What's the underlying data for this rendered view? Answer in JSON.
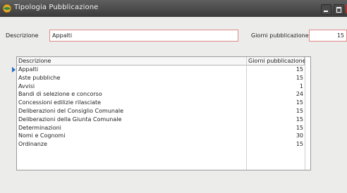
{
  "window": {
    "title": "Tipologia Pubblicazione"
  },
  "form": {
    "descrizione_label": "Descrizione",
    "descrizione_value": "Appalti",
    "giorni_label": "Giorni pubblicazione",
    "giorni_value": "15"
  },
  "grid": {
    "columns": [
      "Descrizione",
      "Giorni pubblicazione"
    ],
    "rows": [
      {
        "desc": "Appalti",
        "days": "15"
      },
      {
        "desc": "Aste pubbliche",
        "days": "15"
      },
      {
        "desc": "Avvisi",
        "days": "1"
      },
      {
        "desc": "Bandi di selezione e concorso",
        "days": "24"
      },
      {
        "desc": "Concessioni edilizie rilasciate",
        "days": "15"
      },
      {
        "desc": "Deliberazioni del Consiglio Comunale",
        "days": "15"
      },
      {
        "desc": "Deliberazioni della Giunta Comunale",
        "days": "15"
      },
      {
        "desc": "Determinazioni",
        "days": "15"
      },
      {
        "desc": "Nomi e Cognomi",
        "days": "30"
      },
      {
        "desc": "Ordinanze",
        "days": "15"
      }
    ],
    "selected_index": 0
  },
  "icons": {
    "app": "app-globe-icon",
    "minimize": "minimize-icon",
    "maximize": "maximize-icon",
    "close": "close-icon",
    "row_pointer": "row-pointer-icon"
  },
  "colors": {
    "titlebar": "#3b3b3b",
    "field_border": "#e08a8a",
    "selection_pointer": "#2a6cc7"
  }
}
